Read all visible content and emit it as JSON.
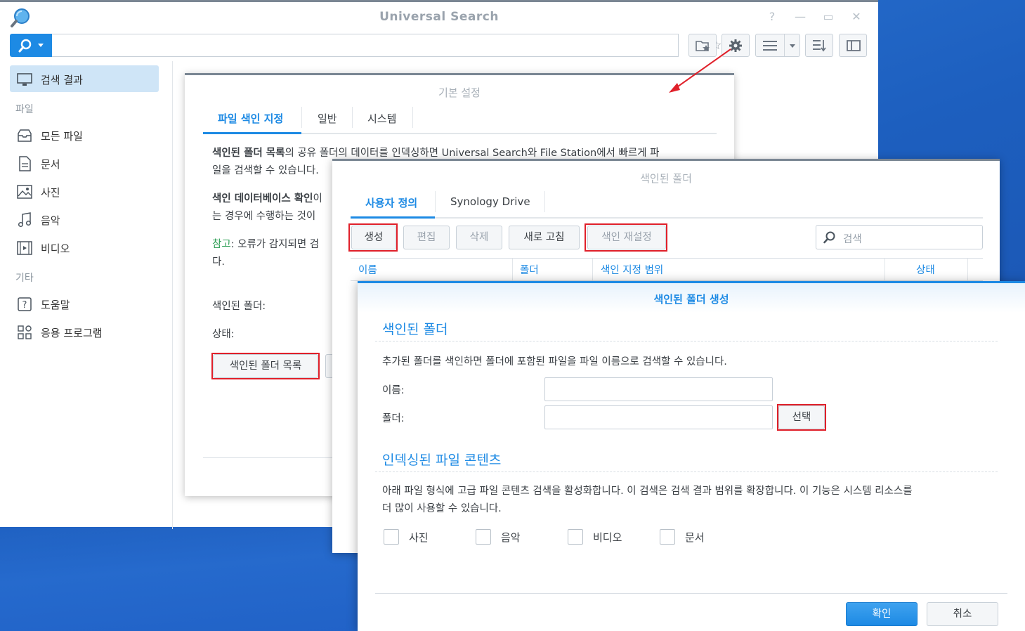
{
  "window": {
    "title": "Universal Search"
  },
  "sidebar": {
    "items": [
      {
        "label": "검색 결과",
        "icon": "monitor-icon",
        "active": true
      },
      {
        "label": "모든 파일",
        "icon": "inbox-icon"
      },
      {
        "label": "문서",
        "icon": "document-icon"
      },
      {
        "label": "사진",
        "icon": "image-icon"
      },
      {
        "label": "음악",
        "icon": "music-icon"
      },
      {
        "label": "비디오",
        "icon": "video-icon"
      },
      {
        "label": "도움말",
        "icon": "help-icon"
      },
      {
        "label": "응용 프로그램",
        "icon": "apps-icon"
      }
    ],
    "groups": {
      "files": "파일",
      "other": "기타"
    }
  },
  "settings_dialog": {
    "title": "기본 설정",
    "tabs": [
      "파일 색인 지정",
      "일반",
      "시스템"
    ],
    "para1_bold": "색인된 폴더 목록",
    "para1_line1": "의 공유 폴더의 데이터를 인덱싱하면 Universal Search와 File Station에서 빠르게 파",
    "para1_line2": "일을 검색할 수 있습니다.",
    "para2_bold": "색인 데이터베이스 확인",
    "para2_rest": "이",
    "para2_line2": "는 경우에 수행하는 것이 ",
    "note_label": "참고",
    "note_text": ": 오류가 감지되면 검",
    "note_line2": "다.",
    "indexed_folder_label": "색인된 폴더:",
    "status_label": "상태:",
    "folder_list_button": "색인된 폴더 목록"
  },
  "indexed_dialog": {
    "title": "색인된 폴더",
    "tabs": [
      "사용자 정의",
      "Synology Drive"
    ],
    "buttons": {
      "create": "생성",
      "edit": "편집",
      "delete": "삭제",
      "refresh": "새로 고침",
      "reindex": "색인 재설정"
    },
    "search_placeholder": "검색",
    "columns": [
      "이름",
      "폴더",
      "색인 지정 범위",
      "상태"
    ]
  },
  "create_dialog": {
    "title": "색인된 폴더 생성",
    "section1_title": "색인된 폴더",
    "section1_desc": "추가된 폴더를 색인하면 폴더에 포함된 파일을 파일 이름으로 검색할 수 있습니다.",
    "name_label": "이름:",
    "folder_label": "폴더:",
    "name_value": "",
    "folder_value": "",
    "select_button": "선택",
    "section2_title": "인덱싱된 파일 콘텐츠",
    "section2_line1": "아래 파일 형식에 고급 파일 콘텐츠 검색을 활성화합니다. 이 검색은 검색 결과 범위를 확장합니다. 이 기능은 시스템 리소스를",
    "section2_line2": "더 많이 사용할 수 있습니다.",
    "checkboxes": [
      "사진",
      "음악",
      "비디오",
      "문서"
    ],
    "ok_button": "확인",
    "cancel_button": "취소"
  },
  "colors": {
    "accent": "#1d8ae4",
    "highlight": "#e0202a",
    "note": "#2e9e55"
  }
}
